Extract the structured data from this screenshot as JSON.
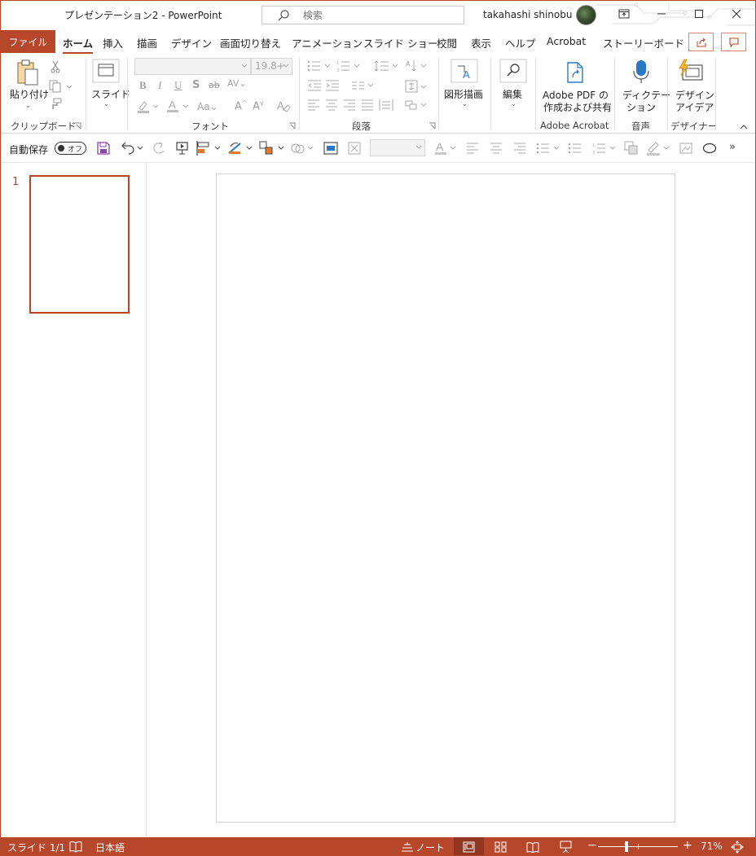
{
  "window": {
    "title": "プレゼンテーション2  -  PowerPoint",
    "search_placeholder": "検索",
    "user_name": "takahashi shinobu"
  },
  "tabs": {
    "file": "ファイル",
    "items": [
      "ホーム",
      "挿入",
      "描画",
      "デザイン",
      "画面切り替え",
      "アニメーション",
      "スライド ショー",
      "校閲",
      "表示",
      "ヘルプ",
      "Acrobat",
      "ストーリーボード"
    ],
    "active": "ホーム"
  },
  "ribbon": {
    "clipboard": {
      "paste_label": "貼り付け",
      "group": "クリップボード"
    },
    "slides": {
      "slide_label": "スライド"
    },
    "font": {
      "group": "フォント",
      "font_size": "19.8+"
    },
    "paragraph": {
      "group": "段落"
    },
    "drawing": {
      "label": "図形描画"
    },
    "editing": {
      "label": "編集"
    },
    "acrobat": {
      "line1": "Adobe PDF の",
      "line2": "作成および共有",
      "group": "Adobe Acrobat"
    },
    "voice": {
      "line1": "ディクテー",
      "line2": "ション",
      "group": "音声"
    },
    "designer": {
      "line1": "デザイン",
      "line2": "アイデア",
      "group": "デザイナー"
    }
  },
  "qat": {
    "autosave_label": "自動保存",
    "autosave_state": "オフ"
  },
  "thumbnails": {
    "slide_number": "1"
  },
  "status": {
    "slide_info": "スライド 1/1",
    "language": "日本語",
    "notes_label": "ノート",
    "zoom": "71%"
  },
  "colors": {
    "accent": "#b7472a"
  }
}
